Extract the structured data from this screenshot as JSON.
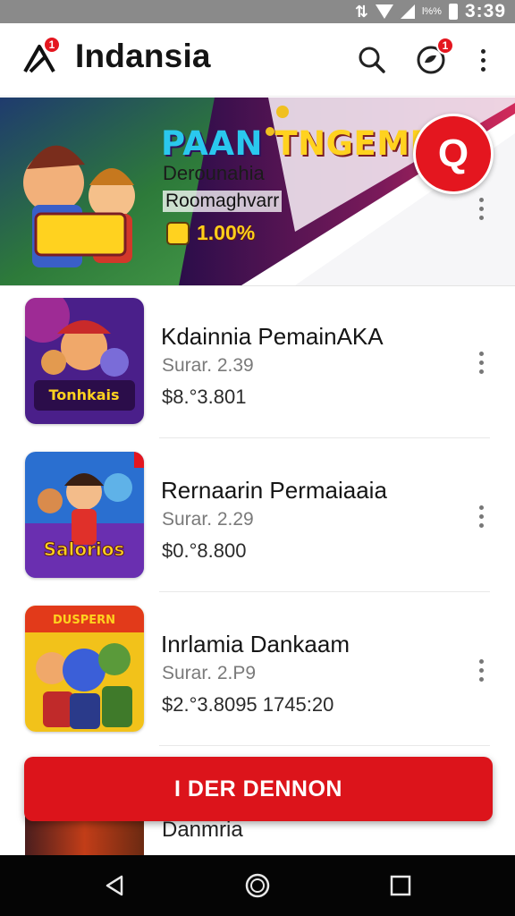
{
  "status_bar": {
    "battery_text": "l%%",
    "time": "3:39"
  },
  "app_bar": {
    "title": "Indansia",
    "logo_badge": "1",
    "chat_badge": "1",
    "icons": [
      "search-icon",
      "chat-icon",
      "more-vertical-icon"
    ]
  },
  "banner": {
    "headline_part1": "PAAN",
    "headline_part2": "TNGEMR",
    "line1": "Derounahia",
    "line2": "Roomaghvarr",
    "rating": "1.00%",
    "badge_letter": "Q"
  },
  "items": [
    {
      "title": "Kdainnia PemainAKA",
      "subtitle": "Surar. 2.39",
      "price": "$8.°3.801"
    },
    {
      "title": "Rernaarin Permaiaaia",
      "subtitle": "Surar. 2.29",
      "price": "$0.°8.800"
    },
    {
      "title": "Inrlamia Dankaam",
      "subtitle": "Surar. 2.P9",
      "price": "$2.°3.8095  1745:20"
    }
  ],
  "thumb_captions": [
    "Tonhkais",
    "Salorios",
    "DUSPERN"
  ],
  "partial_item": {
    "title": "Danmria"
  },
  "cta": {
    "label": "I DER DENNON"
  },
  "colors": {
    "accent_red": "#dc141b",
    "status_bar": "#8a8a8a",
    "nav_bar": "#050505"
  }
}
